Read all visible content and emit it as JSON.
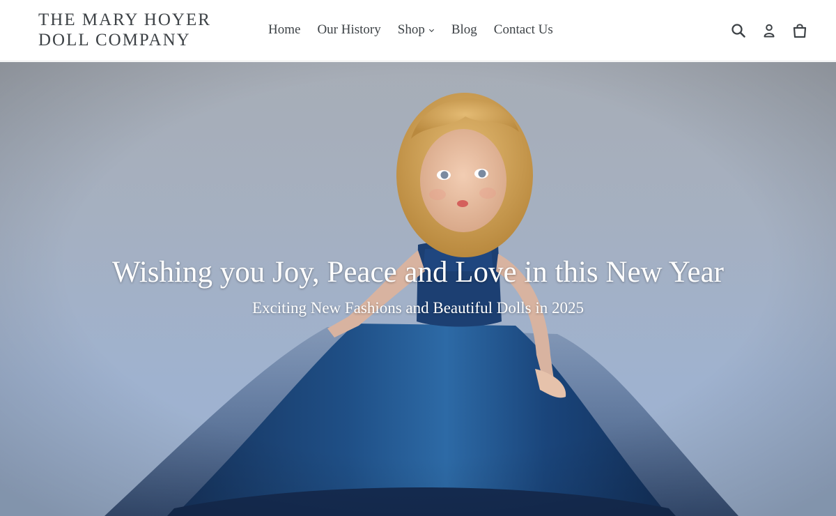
{
  "header": {
    "logo_line1": "THE MARY HOYER",
    "logo_line2": "DOLL COMPANY",
    "nav": {
      "home": "Home",
      "history": "Our History",
      "shop": "Shop",
      "blog": "Blog",
      "contact": "Contact Us"
    },
    "icons": [
      "search-icon",
      "account-icon",
      "cart-icon"
    ]
  },
  "hero": {
    "title": "Wishing you Joy, Peace and Love in this New Year",
    "subtitle": "Exciting New Fashions and Beautiful Dolls in 2025"
  },
  "colors": {
    "text": "#3d4246",
    "hero_text": "#ffffff",
    "dress": "#1e4a82"
  }
}
